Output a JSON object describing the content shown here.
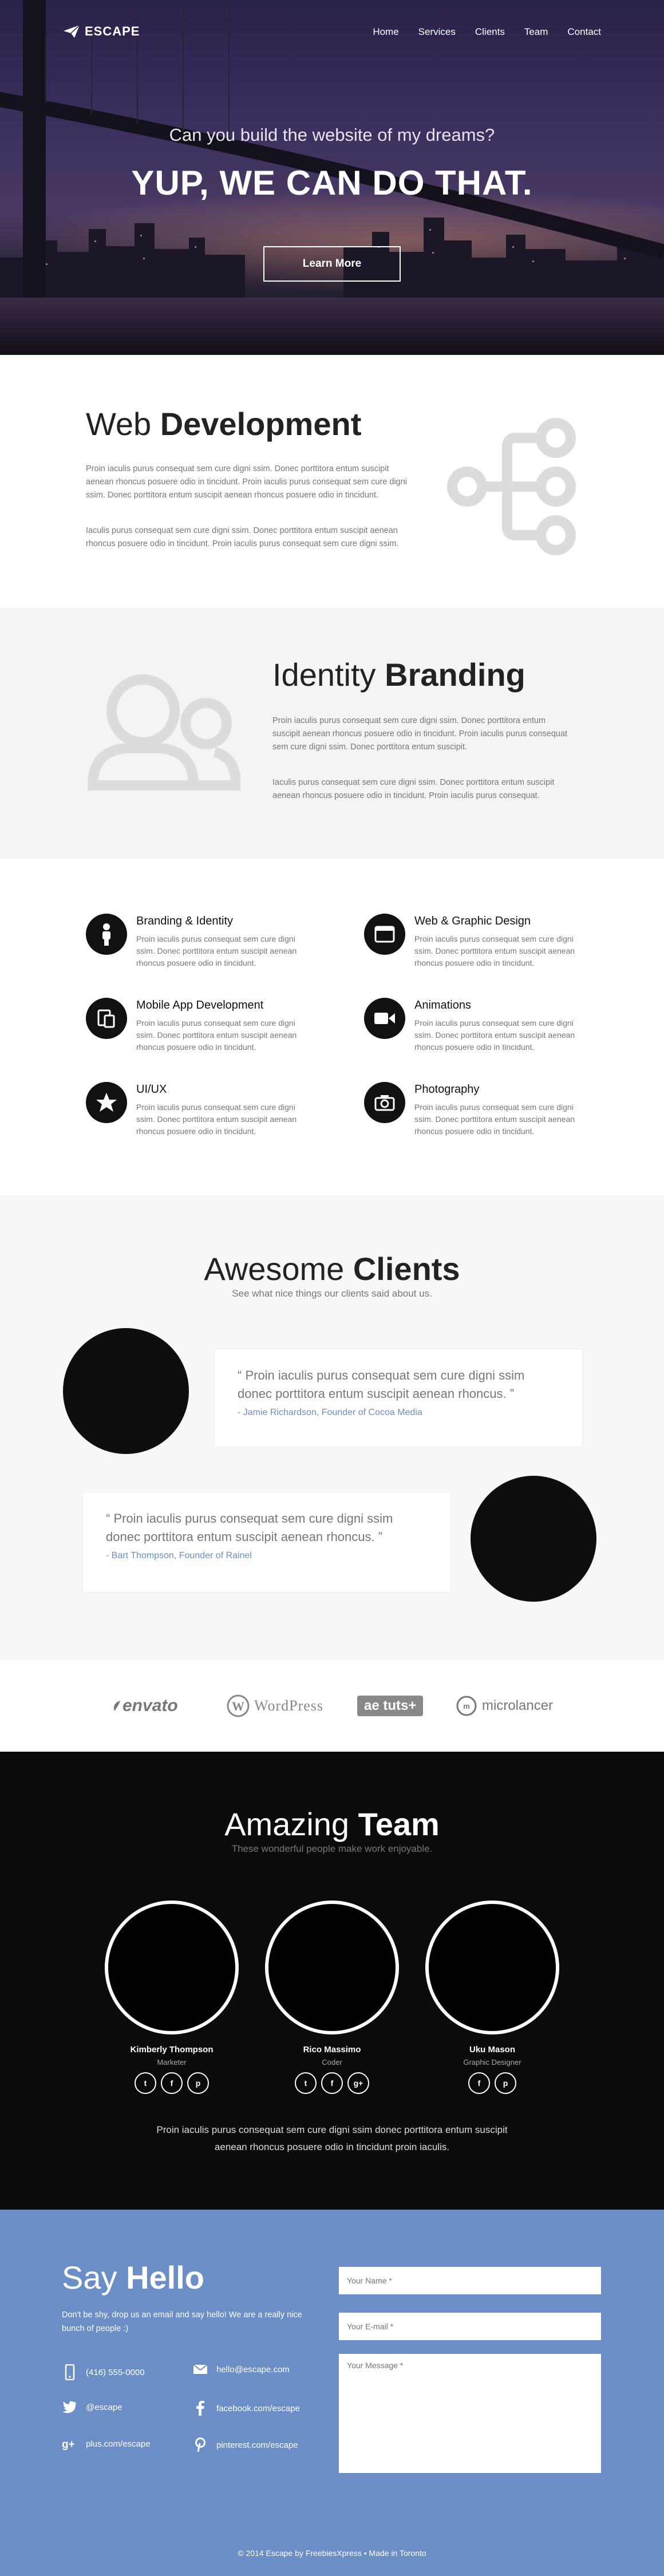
{
  "brand": {
    "name": "ESCAPE"
  },
  "nav": [
    "Home",
    "Services",
    "Clients",
    "Team",
    "Contact"
  ],
  "hero": {
    "subtitle": "Can you build the website of my dreams?",
    "title": "YUP, WE CAN DO THAT.",
    "button": "Learn More"
  },
  "webdev": {
    "title_light": "Web",
    "title_bold": "Development",
    "p1": "Proin iaculis purus consequat sem cure digni ssim. Donec porttitora entum suscipit aenean rhoncus posuere odio in tincidunt. Proin iaculis purus consequat sem cure digni ssim. Donec porttitora entum suscipit aenean rhoncus posuere odio in tincidunt.",
    "p2": "Iaculis purus consequat sem cure digni ssim. Donec porttitora entum suscipit aenean rhoncus posuere odio in tincidunt. Proin iaculis purus consequat sem cure digni ssim.",
    "icon": "share-icon"
  },
  "branding": {
    "title_light": "Identity",
    "title_bold": "Branding",
    "p1": "Proin iaculis purus consequat sem cure digni ssim. Donec porttitora entum suscipit aenean rhoncus posuere odio in tincidunt. Proin iaculis purus consequat sem cure digni ssim. Donec porttitora entum suscipit.",
    "p2": "Iaculis purus consequat sem cure digni ssim. Donec porttitora entum suscipit aenean rhoncus posuere odio in tincidunt. Proin iaculis purus consequat.",
    "icon": "users-icon"
  },
  "services": [
    {
      "title": "Branding & Identity",
      "icon": "figure-icon",
      "desc": "Proin iaculis purus consequat sem cure digni ssim. Donec porttitora entum suscipit aenean rhoncus posuere odio in tincidunt."
    },
    {
      "title": "Web & Graphic Design",
      "icon": "browser-icon",
      "desc": "Proin iaculis purus consequat sem cure digni ssim. Donec porttitora entum suscipit aenean rhoncus posuere odio in tincidunt."
    },
    {
      "title": "Mobile App Development",
      "icon": "devices-icon",
      "desc": "Proin iaculis purus consequat sem cure digni ssim. Donec porttitora entum suscipit aenean rhoncus posuere odio in tincidunt."
    },
    {
      "title": "Animations",
      "icon": "video-camera-icon",
      "desc": "Proin iaculis purus consequat sem cure digni ssim. Donec porttitora entum suscipit aenean rhoncus posuere odio in tincidunt."
    },
    {
      "title": "UI/UX",
      "icon": "star-icon",
      "desc": "Proin iaculis purus consequat sem cure digni ssim. Donec porttitora entum suscipit aenean rhoncus posuere odio in tincidunt."
    },
    {
      "title": "Photography",
      "icon": "camera-icon",
      "desc": "Proin iaculis purus consequat sem cure digni ssim. Donec porttitora entum suscipit aenean rhoncus posuere odio in tincidunt."
    }
  ],
  "clients": {
    "title_light": "Awesome",
    "title_bold": "Clients",
    "subtitle": "See what nice things our clients said about us.",
    "testimonials": [
      {
        "quote": "“ Proin iaculis purus consequat sem cure  digni ssim donec porttitora entum suscipit aenean rhoncus. ”",
        "author": "- Jamie Richardson, Founder of Cocoa Media"
      },
      {
        "quote": "“ Proin iaculis purus consequat sem cure  digni ssim donec porttitora entum suscipit aenean rhoncus. ”",
        "author": "- Bart Thompson, Founder of Rainel"
      }
    ]
  },
  "partners": [
    "envato",
    "WordPress",
    "ae tuts+",
    "microlancer"
  ],
  "team": {
    "title_light": "Amazing",
    "title_bold": "Team",
    "subtitle": "These wonderful people make work enjoyable.",
    "members": [
      {
        "name": "Kimberly Thompson",
        "role": "Marketer",
        "socials": [
          "t",
          "f",
          "p"
        ]
      },
      {
        "name": "Rico Massimo",
        "role": "Coder",
        "socials": [
          "t",
          "f",
          "g+"
        ]
      },
      {
        "name": "Uku Mason",
        "role": "Graphic Designer",
        "socials": [
          "f",
          "p"
        ]
      }
    ],
    "text": "Proin iaculis purus consequat sem cure  digni ssim donec porttitora entum suscipit aenean rhoncus posuere odio in tincidunt proin iaculis."
  },
  "contact": {
    "title_light": "Say",
    "title_bold": "Hello",
    "text": "Don't be shy, drop us an email and say hello! We are a really nice bunch of people :)",
    "items": [
      {
        "icon": "phone-icon",
        "text": "(416) 555-0000"
      },
      {
        "icon": "mail-icon",
        "text": "hello@escape.com"
      },
      {
        "icon": "twitter-icon",
        "text": "@escape"
      },
      {
        "icon": "facebook-icon",
        "text": "facebook.com/escape"
      },
      {
        "icon": "google-plus-icon",
        "text": "plus.com/escape"
      },
      {
        "icon": "pinterest-icon",
        "text": "pinterest.com/escape"
      }
    ],
    "form": {
      "name_placeholder": "Your Name *",
      "email_placeholder": "Your E-mail *",
      "message_placeholder": "Your Message *"
    }
  },
  "footer": "© 2014 Escape by FreebiesXpress • Made in Toronto",
  "colors": {
    "accent": "#6b8ec7",
    "dark": "#0b0b0b",
    "link": "#6a8fc8"
  }
}
